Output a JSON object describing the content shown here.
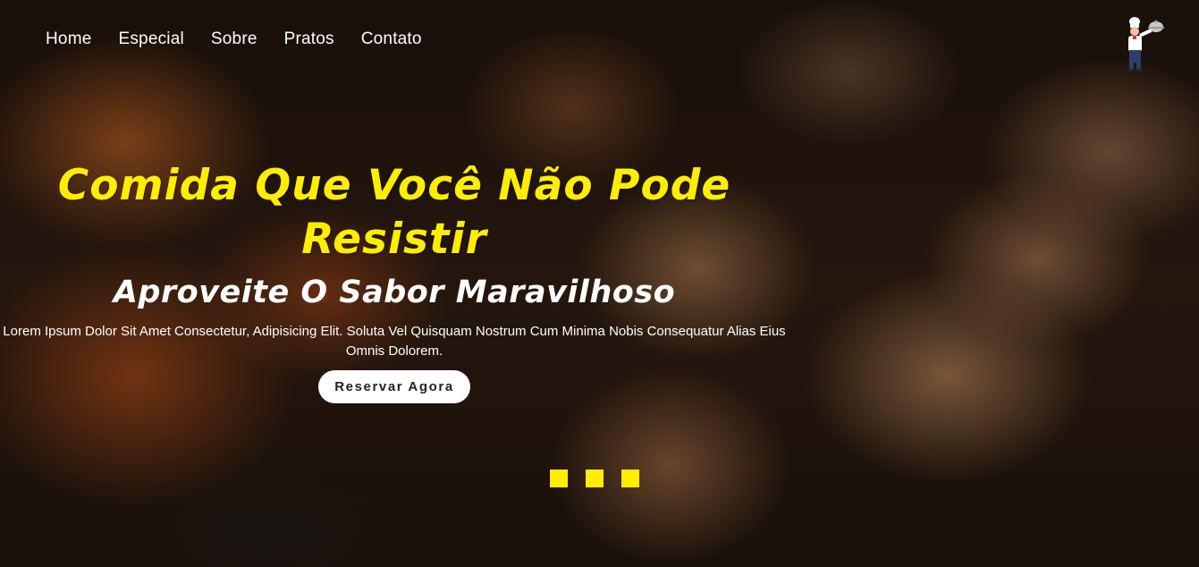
{
  "nav": {
    "items": [
      {
        "label": "Home"
      },
      {
        "label": "Especial"
      },
      {
        "label": "Sobre"
      },
      {
        "label": "Pratos"
      },
      {
        "label": "Contato"
      }
    ]
  },
  "logo": {
    "icon": "chef-icon"
  },
  "hero": {
    "title": "Comida Que Você Não Pode Resistir",
    "subtitle": "Aproveite O Sabor Maravilhoso",
    "description": "Lorem Ipsum Dolor Sit Amet Consectetur, Adipisicing Elit. Soluta Vel Quisquam Nostrum Cum Minima Nobis Consequatur Alias Eius Omnis Dolorem.",
    "cta_label": "Reservar Agora"
  },
  "slider": {
    "dot_count": 3
  },
  "colors": {
    "accent": "#ffee00",
    "text": "#ffffff",
    "button_bg": "#ffffff"
  }
}
